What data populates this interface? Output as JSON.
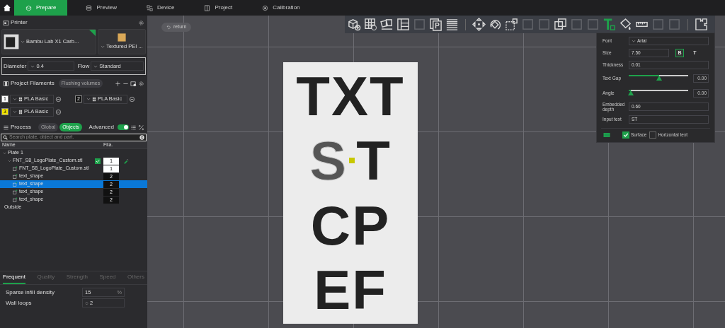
{
  "top_tabs": [
    {
      "label": "Prepare",
      "kind": "cube",
      "selected": true
    },
    {
      "label": "Preview",
      "kind": "stack",
      "selected": false
    },
    {
      "label": "Device",
      "kind": "device",
      "selected": false
    },
    {
      "label": "Project",
      "kind": "book",
      "selected": false
    },
    {
      "label": "Calibration",
      "kind": "target",
      "selected": false
    }
  ],
  "printer": {
    "title": "Printer",
    "printer_name": "Bambu Lab X1 Carb...",
    "plate_type": "Textured PEI ...",
    "diameter_label": "Diameter",
    "diameter": "0.4",
    "flow_label": "Flow",
    "flow": "Standard"
  },
  "filaments": {
    "title": "Project Filaments",
    "flushing_button": "Flushing volumes",
    "items": [
      {
        "index": "1",
        "name": "PLA Basic",
        "color": "#ffffff"
      },
      {
        "index": "2",
        "name": "PLA Basic",
        "color": "#111111"
      },
      {
        "index": "3",
        "name": "PLA Basic",
        "color": "#f5e600"
      }
    ]
  },
  "process": {
    "title": "Process",
    "tabs": [
      {
        "label": "Global",
        "selected": false
      },
      {
        "label": "Objects",
        "selected": true
      }
    ],
    "advanced_label": "Advanced",
    "advanced_on": true,
    "search_placeholder": "Search plate, object and part.",
    "columns": [
      "Name",
      "Fila."
    ],
    "tree": [
      {
        "label": "Plate 1",
        "expanded": true,
        "children": [
          {
            "label": "FNT_S8_LogoPlate_Custom.stl",
            "expanded": true,
            "checked": true,
            "fila": "1",
            "color": "#ffffff",
            "children": [
              {
                "label": "FNT_S8_LogoPlate_Custom.stl",
                "fila": "1",
                "color": "#ffffff",
                "selected": false
              },
              {
                "label": "text_shape",
                "fila": "2",
                "color": "#111111",
                "selected": false
              },
              {
                "label": "text_shape",
                "fila": "2",
                "color": "#111111",
                "selected": true
              },
              {
                "label": "text_shape",
                "fila": "2",
                "color": "#111111",
                "selected": false
              },
              {
                "label": "text_shape",
                "fila": "2",
                "color": "#111111",
                "selected": false
              }
            ]
          }
        ]
      },
      {
        "label": "Outside"
      }
    ]
  },
  "settings_tabs": [
    {
      "label": "Frequent",
      "selected": true
    },
    {
      "label": "Quality",
      "selected": false
    },
    {
      "label": "Strength",
      "selected": false
    },
    {
      "label": "Speed",
      "selected": false
    },
    {
      "label": "Others",
      "selected": false
    }
  ],
  "settings": [
    {
      "label": "Sparse infill density",
      "value": "15",
      "unit": "%",
      "kind": "percent"
    },
    {
      "label": "Wall loops",
      "value": "2",
      "kind": "spin"
    }
  ],
  "canvas": {
    "return_button": "return",
    "plate_lines": [
      [
        {
          "text": "TXT",
          "selected": false
        }
      ],
      [
        {
          "text": "S",
          "selected": true
        },
        {
          "text": "T",
          "selected": false
        }
      ],
      [
        {
          "text": "CP",
          "selected": false
        }
      ],
      [
        {
          "text": "EF",
          "selected": false
        }
      ]
    ]
  },
  "toolbar": [
    [
      {
        "kind": "cube-add",
        "disabled": false,
        "selected": false
      },
      {
        "kind": "grid-add",
        "disabled": false,
        "selected": false
      },
      {
        "kind": "cards",
        "disabled": false,
        "selected": false
      },
      {
        "kind": "panels",
        "disabled": false,
        "selected": false
      },
      {
        "kind": "square",
        "disabled": true,
        "selected": false
      },
      {
        "kind": "page",
        "disabled": false,
        "selected": false
      },
      {
        "kind": "stripes",
        "disabled": false,
        "selected": false
      }
    ],
    [
      {
        "kind": "move",
        "disabled": false,
        "selected": false
      },
      {
        "kind": "rotate",
        "disabled": false,
        "selected": false
      },
      {
        "kind": "scale",
        "disabled": false,
        "selected": false
      },
      {
        "kind": "square",
        "disabled": true,
        "selected": false
      },
      {
        "kind": "square",
        "disabled": true,
        "selected": false
      },
      {
        "kind": "squares",
        "disabled": false,
        "selected": false
      },
      {
        "kind": "square",
        "disabled": true,
        "selected": false
      },
      {
        "kind": "square",
        "disabled": true,
        "selected": false
      },
      {
        "kind": "text",
        "disabled": false,
        "selected": true
      },
      {
        "kind": "bucket",
        "disabled": false,
        "selected": false
      },
      {
        "kind": "ruler",
        "disabled": false,
        "selected": false
      },
      {
        "kind": "square",
        "disabled": true,
        "selected": false
      },
      {
        "kind": "square",
        "disabled": true,
        "selected": false
      }
    ],
    [
      {
        "kind": "puzzle",
        "disabled": false,
        "selected": false
      }
    ]
  ],
  "text_panel": {
    "font_label": "Font",
    "font": "Arial",
    "size_label": "Size",
    "size": "7.50",
    "style_buttons": [
      {
        "label": "B",
        "kind": "bold",
        "selected": true
      },
      {
        "label": "T",
        "kind": "italic",
        "selected": false
      }
    ],
    "thickness_label": "Thickness",
    "thickness": "0.01",
    "sliders": [
      {
        "label": "Text Gap",
        "level": 0.51,
        "reading": "0.00"
      },
      {
        "label": "Angle",
        "level": 0.03,
        "reading": "0.00"
      }
    ],
    "depth_label": "Embedded depth",
    "depth": "0.60",
    "input_label": "Input text",
    "input": "ST",
    "surface_label": "Surface",
    "surface_checked": true,
    "horizontal_label": "Horizontal text",
    "horizontal_checked": false
  }
}
